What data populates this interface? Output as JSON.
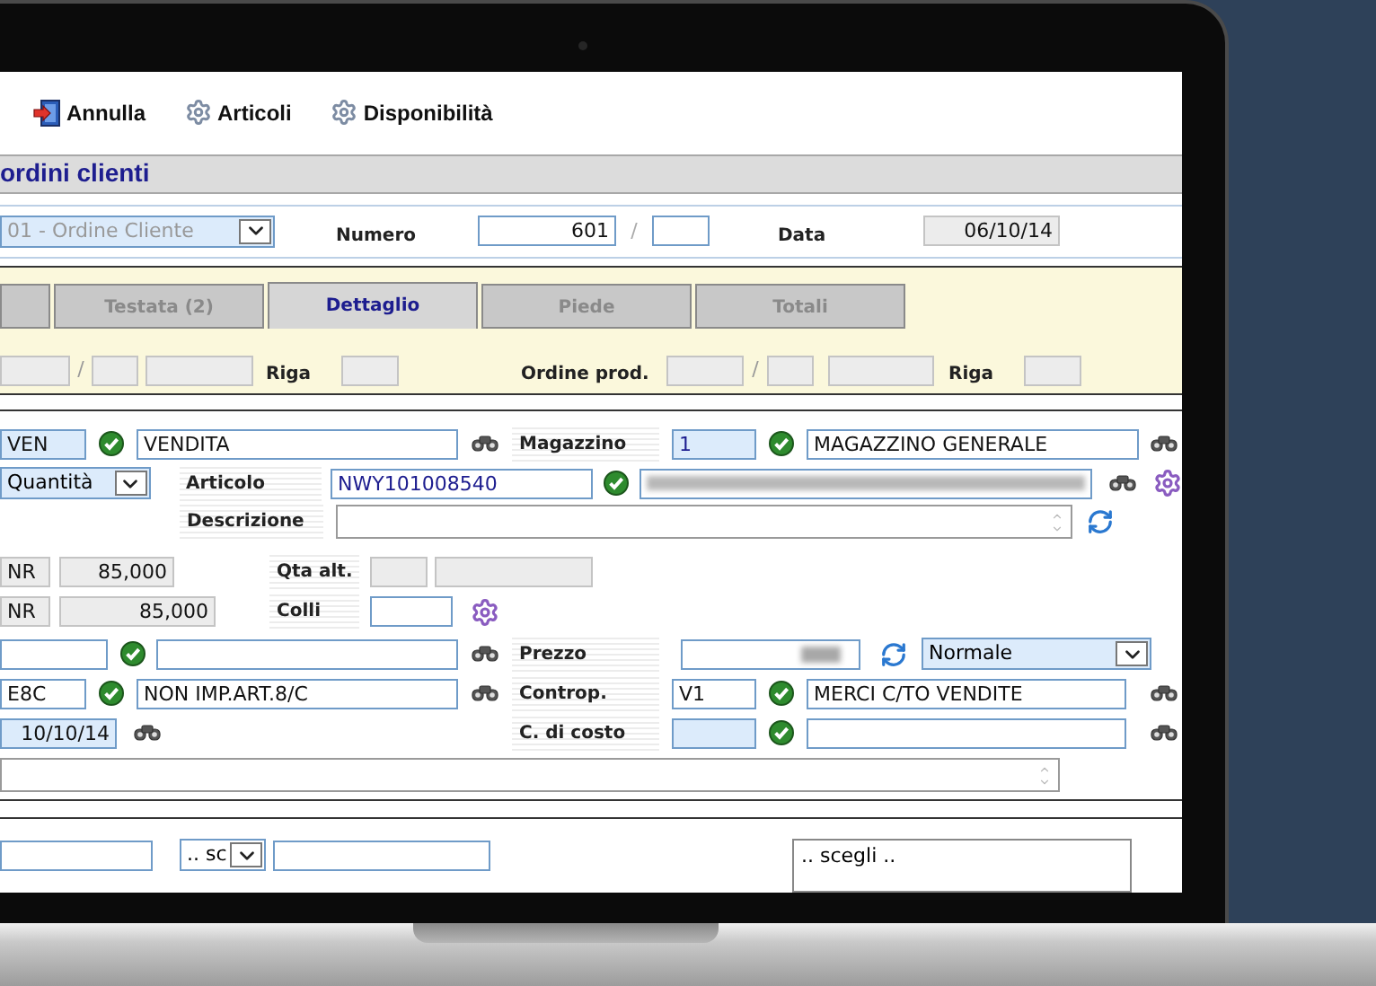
{
  "toolbar": [
    {
      "label": "Annulla",
      "kind": "exit"
    },
    {
      "label": "Articoli",
      "kind": "gear"
    },
    {
      "label": "Disponibilità",
      "kind": "gear"
    }
  ],
  "title": "ordini clienti",
  "header": {
    "document_type": "01 - Ordine Cliente",
    "numero_label": "Numero",
    "numero": "601",
    "separator": "/",
    "data_label": "Data",
    "data": "06/10/14"
  },
  "tabs": [
    {
      "label": "Testata (2)",
      "selected": false
    },
    {
      "label": "Dettaglio",
      "selected": true
    },
    {
      "label": "Piede",
      "selected": false
    },
    {
      "label": "Totali",
      "selected": false
    }
  ],
  "links": {
    "separator_1": "/",
    "riga_label_1": "Riga",
    "ordine_prod_label": "Ordine prod.",
    "separator_2": "/",
    "riga_label_2": "Riga"
  },
  "detail": {
    "causale": {
      "code": "VEN",
      "description": "VENDITA"
    },
    "magazzino": {
      "label": "Magazzino",
      "code": "1",
      "description": "MAGAZZINO GENERALE"
    },
    "unit_select": "Quantità",
    "articolo": {
      "label": "Articolo",
      "code": "NWY101008540"
    },
    "descrizione_label": "Descrizione",
    "quantities": [
      {
        "unit": "NR",
        "value": "85,000"
      },
      {
        "unit": "NR",
        "value": "85,000"
      }
    ],
    "qta_alt_label": "Qta alt.",
    "colli_label": "Colli",
    "prezzo_label": "Prezzo",
    "listino": "Normale",
    "iva": {
      "code": "E8C",
      "description": "NON IMP.ART.8/C"
    },
    "contropartita": {
      "label": "Controp.",
      "code": "V1",
      "description": "MERCI C/TO VENDITE"
    },
    "delivery_date": "10/10/14",
    "centro_costo_label": "C. di costo"
  },
  "footer": {
    "discount_select": ".. sc",
    "list_first": ".. scegli .."
  }
}
